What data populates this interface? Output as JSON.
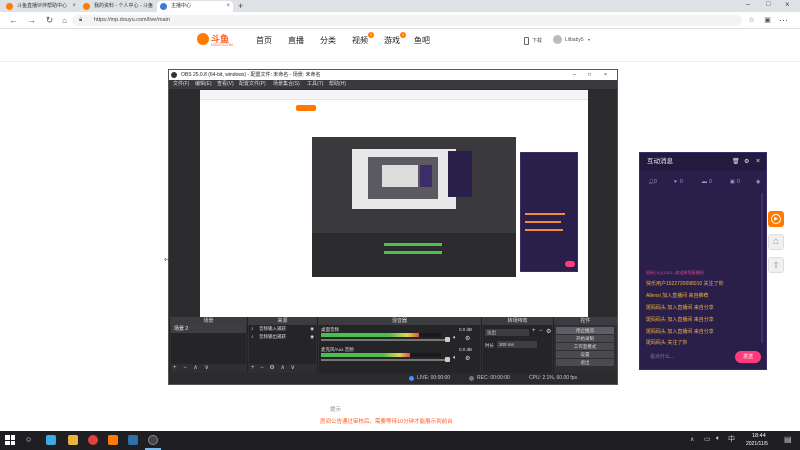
{
  "browser": {
    "tabs": [
      {
        "label": "斗鱼直播伙伴帮助中心",
        "color": "#ff7a00"
      },
      {
        "label": "我的资料 - 个人中心 - 斗鱼",
        "color": "#ff7a00"
      },
      {
        "label": "主播中心",
        "color": "#3a7bd5"
      }
    ],
    "new_tab": "+",
    "url": "https://mp.douyu.com/live/main"
  },
  "site": {
    "logo": "斗鱼",
    "logo_sub": "DOUYU.COM",
    "nav": [
      "首页",
      "直播",
      "分类",
      "视频",
      "游戏",
      "鱼吧"
    ],
    "nav_badges": {
      "视频": "2",
      "游戏": "1"
    },
    "download": "下载",
    "user": "Lilbaby5"
  },
  "obs": {
    "title": "OBS 25.0.8 (64-bit, windows) - 配置文件: 未命名 - 场景: 未命名",
    "menu": [
      "文件(F)",
      "编辑(E)",
      "查看(V)",
      "配置文件(P)",
      "场景集合(S)",
      "工具(T)",
      "帮助(H)"
    ],
    "docks": {
      "scenes": {
        "title": "场景",
        "items": [
          "场景 2"
        ]
      },
      "sources": {
        "title": "来源",
        "items": [
          "音频输入捕获",
          "音频输出捕获"
        ]
      },
      "mixer": {
        "title": "混音器",
        "tracks": [
          {
            "name": "桌面音频",
            "db": "0.0 dB",
            "level": 0.82
          },
          {
            "name": "麦克风/Aux 音频",
            "db": "0.0 dB",
            "level": 0.74
          }
        ]
      },
      "transitions": {
        "title": "转场特效",
        "type": "淡出",
        "duration_label": "时长",
        "duration": "300 ms"
      },
      "controls": {
        "title": "控件",
        "buttons": [
          "停止推流",
          "开始录制",
          "工作室模式",
          "设置",
          "退出"
        ]
      }
    },
    "status": {
      "live": "LIVE: 00:00:00",
      "rec": "REC: 00:00:00",
      "cpu": "CPU: 2.1%, 60.00 fps"
    }
  },
  "chat": {
    "title": "互动消息",
    "stats": [
      "0",
      "0",
      "0",
      "0"
    ],
    "messages": [
      {
        "text": "斑码小心(1521..)欢迎来到直播间",
        "color": "#e04b8d"
      },
      {
        "text": "快乐用户1522720098010 关注了你",
        "color": "#f0b43c"
      },
      {
        "text": "Allensi 加入直播间 来自推荐",
        "color": "#f0b43c"
      },
      {
        "text": "斑码码头 加入直播间 来自分享",
        "color": "#f0b43c"
      },
      {
        "text": "斑码码头 加入直播间 来自分享",
        "color": "#f0b43c"
      },
      {
        "text": "斑码码头 加入直播间 来自分享",
        "color": "#f0b43c"
      },
      {
        "text": "斑码码头 关注了你",
        "color": "#f0b43c"
      }
    ],
    "input_placeholder": "说点什么...",
    "send": "发送"
  },
  "page_footer": {
    "line1": "提示",
    "line2": "房间公告通过审核后，需要等待10分钟才能展示到前台"
  },
  "taskbar": {
    "time": "18:44",
    "date": "2021/11/5"
  }
}
